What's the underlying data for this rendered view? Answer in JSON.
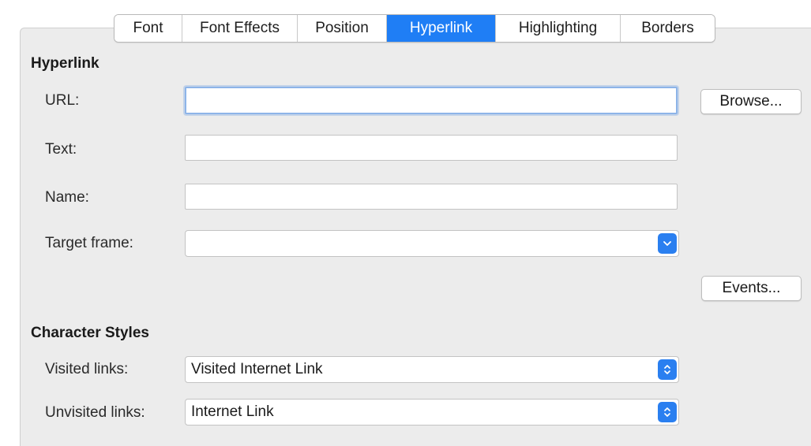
{
  "tabs": [
    {
      "label": "Font"
    },
    {
      "label": "Font Effects"
    },
    {
      "label": "Position"
    },
    {
      "label": "Hyperlink"
    },
    {
      "label": "Highlighting"
    },
    {
      "label": "Borders"
    }
  ],
  "active_tab": "Hyperlink",
  "hyperlink": {
    "title": "Hyperlink",
    "url_label": "URL:",
    "url_value": "",
    "text_label": "Text:",
    "text_value": "",
    "name_label": "Name:",
    "name_value": "",
    "target_frame_label": "Target frame:",
    "target_frame_value": "",
    "browse_label": "Browse...",
    "events_label": "Events..."
  },
  "character_styles": {
    "title": "Character Styles",
    "visited_label": "Visited links:",
    "visited_value": "Visited Internet Link",
    "unvisited_label": "Unvisited links:",
    "unvisited_value": "Internet Link"
  },
  "colors": {
    "accent": "#1f7ef5",
    "panel_background": "#ececec"
  },
  "icons": {
    "dropdown": "chevron-down-icon",
    "spinner": "up-down-chevrons-icon"
  }
}
